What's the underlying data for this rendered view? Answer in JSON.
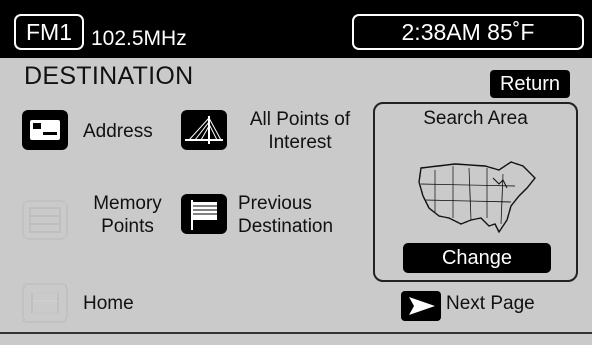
{
  "status_bar": {
    "band": "FM1",
    "frequency": "102.5MHz",
    "clock": "2:38AM 85˚F"
  },
  "page": {
    "title": "DESTINATION",
    "return_label": "Return"
  },
  "options": {
    "address": "Address",
    "poi_line1": "All Points of",
    "poi_line2": "Interest",
    "memory_line1": "Memory",
    "memory_line2": "Points",
    "previous_line1": "Previous",
    "previous_line2": "Destination",
    "home": "Home"
  },
  "search_area": {
    "title": "Search Area",
    "change_label": "Change"
  },
  "navigation": {
    "next_page": "Next Page"
  },
  "icons": {
    "address": "address-card-icon",
    "poi": "bridge-icon",
    "memory": "memory-points-icon",
    "previous": "flag-icon",
    "home": "home-icon",
    "next": "arrow-right-icon",
    "map": "north-america-map-icon"
  }
}
